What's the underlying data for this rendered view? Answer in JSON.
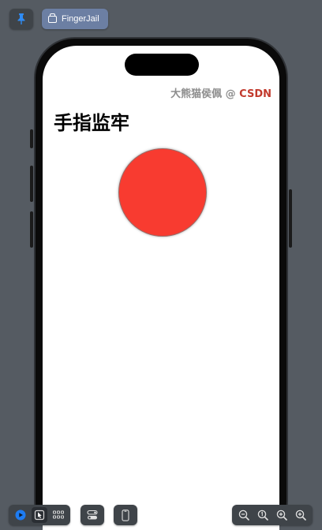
{
  "toolbar": {
    "pin_icon": "pin-icon",
    "tab_label": "FingerJail"
  },
  "app": {
    "credit_author": "大熊猫侯佩 @ ",
    "credit_brand": "CSDN",
    "title": "手指监牢",
    "circle_color": "#f83b30"
  },
  "bottom_toolbar": {
    "left_tools": [
      "live-preview-icon",
      "selectable-mode-icon",
      "variants-grid-icon"
    ],
    "middle_tools": [
      "device-settings-icon",
      "preview-on-device-icon"
    ],
    "zoom_tools": [
      "zoom-out-icon",
      "zoom-100-icon",
      "zoom-in-icon",
      "zoom-to-fit-icon"
    ]
  },
  "colors": {
    "background": "#555b62",
    "accent": "#1e7cf2",
    "tab_chip": "#6c7fa3",
    "brand": "#c23a2d"
  }
}
